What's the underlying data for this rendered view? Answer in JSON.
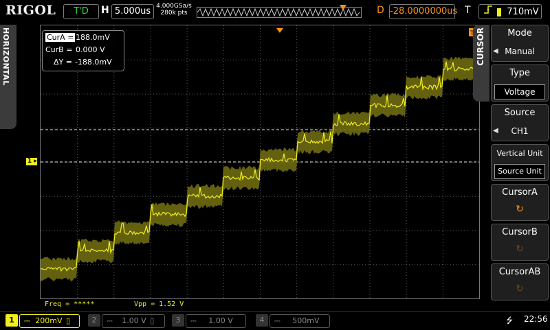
{
  "brand": "RIGOL",
  "run_status": "T'D",
  "horizontal": {
    "label": "H",
    "timebase": "5.000us",
    "sample_rate": "4.000GSa/s",
    "mem_depth": "280k pts",
    "tab_label": "HORIZONTAL"
  },
  "delay": {
    "label": "D",
    "value": "-28.0000000us"
  },
  "trigger": {
    "label": "T",
    "level": "710mV",
    "icon": "rising-edge-icon"
  },
  "cursor_readout": {
    "cura_label": "CurA =",
    "cura_value": "188.0mV",
    "curb_label": "CurB =",
    "curb_value": "0.000 V",
    "delta_label": "ΔY =",
    "delta_value": "-188.0mV"
  },
  "measurements": {
    "freq": "Freq = *****",
    "vpp": "Vpp = 1.52 V"
  },
  "menu": {
    "tab_label": "CURSOR",
    "items": [
      {
        "title": "Mode",
        "value": "Manual"
      },
      {
        "title": "Type",
        "value": "Voltage"
      },
      {
        "title": "Source",
        "value": "CH1"
      },
      {
        "title": "Vertical Unit",
        "value": "Source Unit"
      },
      {
        "title": "CursorA",
        "value": "knob"
      },
      {
        "title": "CursorB",
        "value": "knob"
      },
      {
        "title": "CursorAB",
        "value": "knob"
      }
    ]
  },
  "channels": [
    {
      "num": "1",
      "scale": "200mV"
    },
    {
      "num": "2",
      "scale": "1.00 V"
    },
    {
      "num": "3",
      "scale": "1.00 V"
    },
    {
      "num": "4",
      "scale": "500mV"
    }
  ],
  "status": {
    "clock": "22:56",
    "usb_icon": "usb-icon"
  },
  "colors": {
    "ch1": "#f2ef1c",
    "accent": "#f7931e",
    "run": "#2ee02e"
  }
}
